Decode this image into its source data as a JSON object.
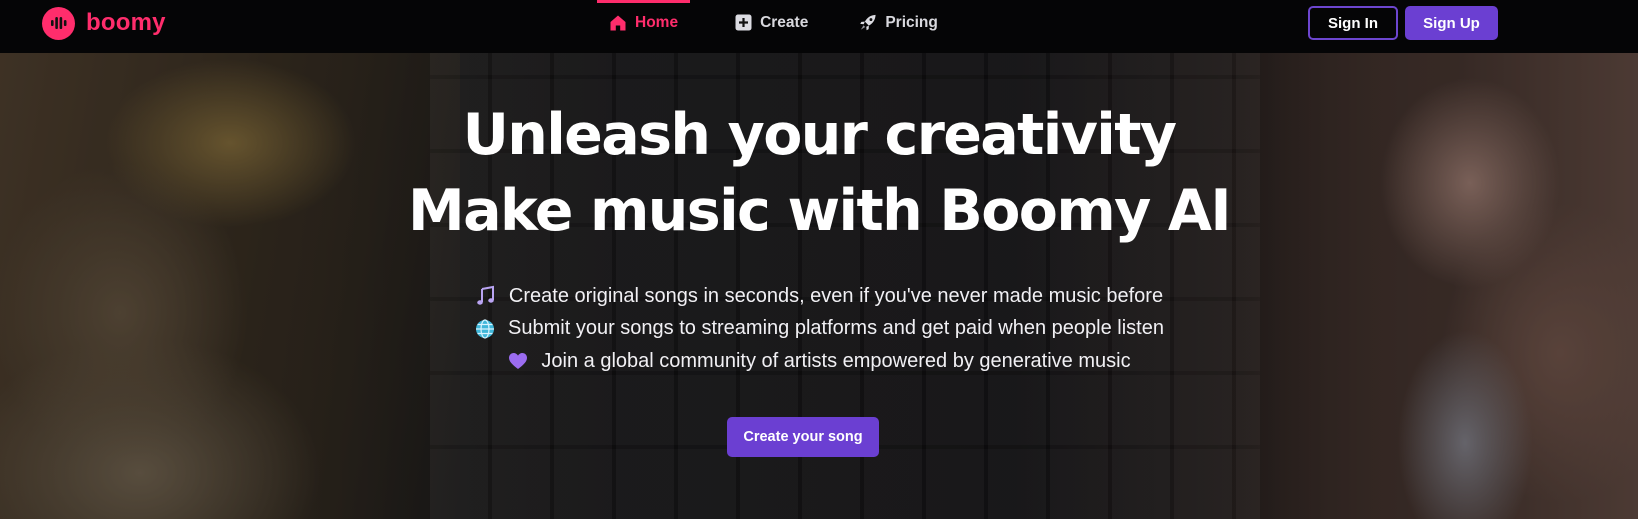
{
  "brand": {
    "name": "boomy",
    "color": "#ff2d6c",
    "icon": "boomy-logo-icon"
  },
  "nav": {
    "items": [
      {
        "label": "Home",
        "icon": "home-icon",
        "active": true
      },
      {
        "label": "Create",
        "icon": "plus-square-icon",
        "active": false
      },
      {
        "label": "Pricing",
        "icon": "rocket-icon",
        "active": false
      }
    ],
    "active_color": "#ff2d6c"
  },
  "auth": {
    "sign_in": "Sign In",
    "sign_up": "Sign Up",
    "accent": "#6b3fd2"
  },
  "hero": {
    "headline_line1": "Unleash your creativity",
    "headline_line2": "Make music with Boomy AI",
    "features": [
      {
        "icon": "music-notes-icon",
        "text": "Create original songs in seconds, even if you've never made music before"
      },
      {
        "icon": "globe-icon",
        "text": "Submit your songs to streaming platforms and get paid when people listen"
      },
      {
        "icon": "purple-heart-icon",
        "text": "Join a global community of artists empowered by generative music"
      }
    ],
    "cta": "Create your song"
  }
}
